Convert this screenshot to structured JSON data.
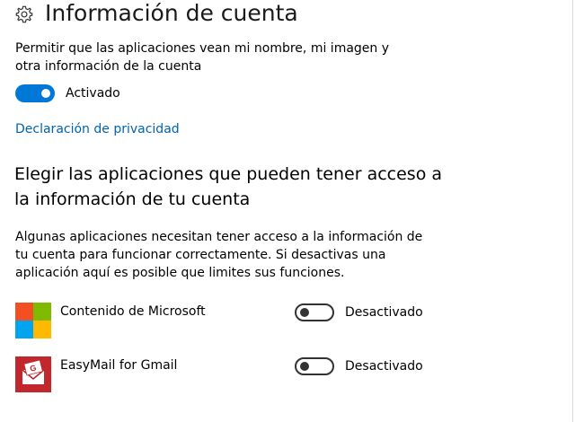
{
  "header": {
    "icon": "gear-icon",
    "title": "Información de cuenta"
  },
  "account_access": {
    "description": "Permitir que las aplicaciones vean mi nombre, mi imagen y otra información de la cuenta",
    "toggle_on": true,
    "toggle_state": "Activado",
    "privacy_link": "Declaración de privacidad"
  },
  "apps_section": {
    "title": "Elegir las aplicaciones que pueden tener acceso a la información de tu cuenta",
    "description": "Algunas aplicaciones necesitan tener acceso a la información de tu cuenta para funcionar correctamente. Si desactivas una aplicación aquí es posible que limites sus funciones.",
    "apps": [
      {
        "name": "Contenido de Microsoft",
        "icon": "microsoft-logo-icon",
        "toggle_on": false,
        "state": "Desactivado"
      },
      {
        "name": "EasyMail for Gmail",
        "icon": "easymail-envelope-icon",
        "toggle_on": false,
        "state": "Desactivado"
      }
    ]
  },
  "colors": {
    "accent": "#0078d7",
    "link": "#0063b1",
    "microsoft_red": "#f25022",
    "microsoft_green": "#7fba00",
    "microsoft_blue": "#00a4ef",
    "microsoft_yellow": "#ffb900",
    "easymail_red": "#c1272d"
  }
}
